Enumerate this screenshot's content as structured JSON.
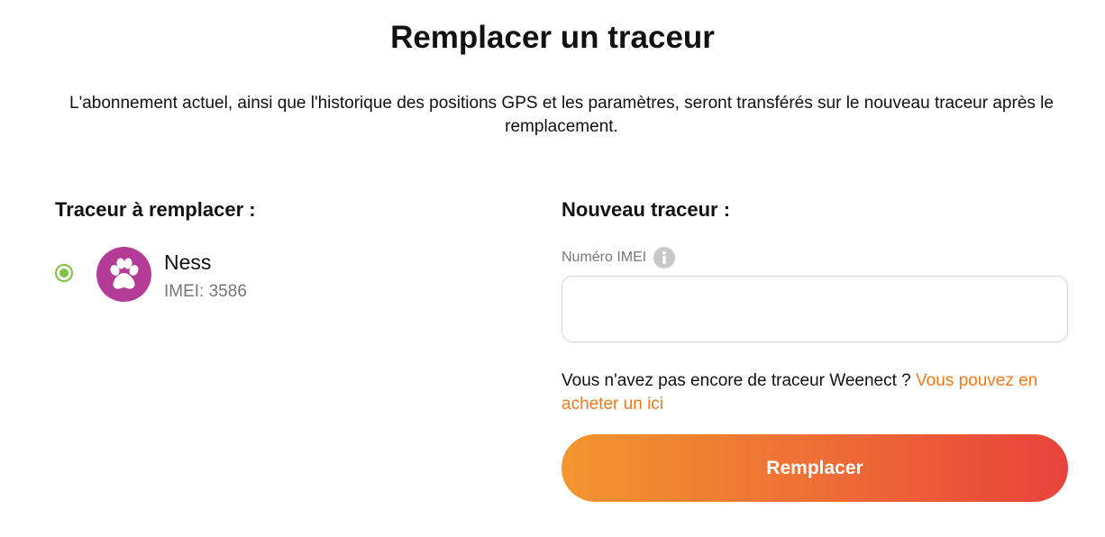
{
  "page": {
    "title": "Remplacer un traceur",
    "description": "L'abonnement actuel, ainsi que l'historique des positions GPS et les paramètres, seront transférés sur le nouveau traceur après le remplacement."
  },
  "left_section": {
    "heading": "Traceur à remplacer :",
    "tracker": {
      "name": "Ness",
      "imei": "IMEI: 3586",
      "selected": true,
      "avatar_icon": "paw-icon",
      "avatar_color": "#b43c96"
    }
  },
  "right_section": {
    "heading": "Nouveau traceur :",
    "imei_field": {
      "label": "Numéro IMEI",
      "value": "",
      "placeholder": ""
    },
    "info_icon": "info-icon",
    "buy_prompt": "Vous n'avez pas encore de traceur Weenect ? ",
    "buy_link": "Vous pouvez en acheter un ici",
    "submit_label": "Remplacer"
  },
  "colors": {
    "accent_green": "#7dc242",
    "link_orange": "#f07a1e",
    "button_gradient_start": "#f29530",
    "button_gradient_end": "#e8423b"
  }
}
